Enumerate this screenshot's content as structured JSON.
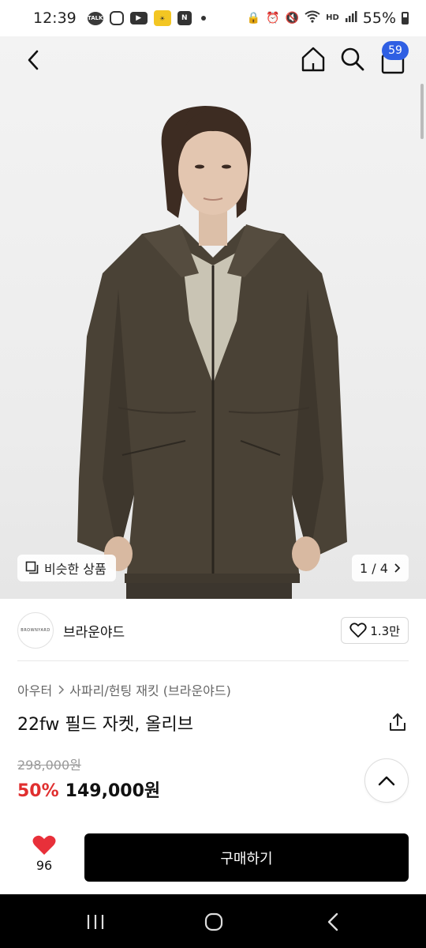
{
  "status_bar": {
    "time": "12:39",
    "notification_icons": [
      "talk-icon",
      "instagram-icon",
      "youtube-icon",
      "app-icon",
      "naver-icon"
    ],
    "talk_text": "TALK",
    "n_text": "N",
    "hd_text": "HD",
    "battery": "55%"
  },
  "header": {
    "cart_count": "59"
  },
  "gallery": {
    "similar_label": "비슷한 상품",
    "page": "1 / 4"
  },
  "shop": {
    "logo_text": "BROWNYARD",
    "name": "브라운야드",
    "likes": "1.3만"
  },
  "product": {
    "breadcrumb": [
      "아우터",
      "사파리/헌팅 재킷 (브라운야드)"
    ],
    "title": "22fw 필드 자켓, 올리브",
    "original_price": "298,000원",
    "discount": "50%",
    "price": "149,000원"
  },
  "actions": {
    "wish_count": "96",
    "buy_label": "구매하기"
  },
  "colors": {
    "accent_blue": "#2f5fe3",
    "discount_red": "#e02f2f",
    "heart_red": "#e8303a",
    "jacket_olive": "#4a4236"
  }
}
